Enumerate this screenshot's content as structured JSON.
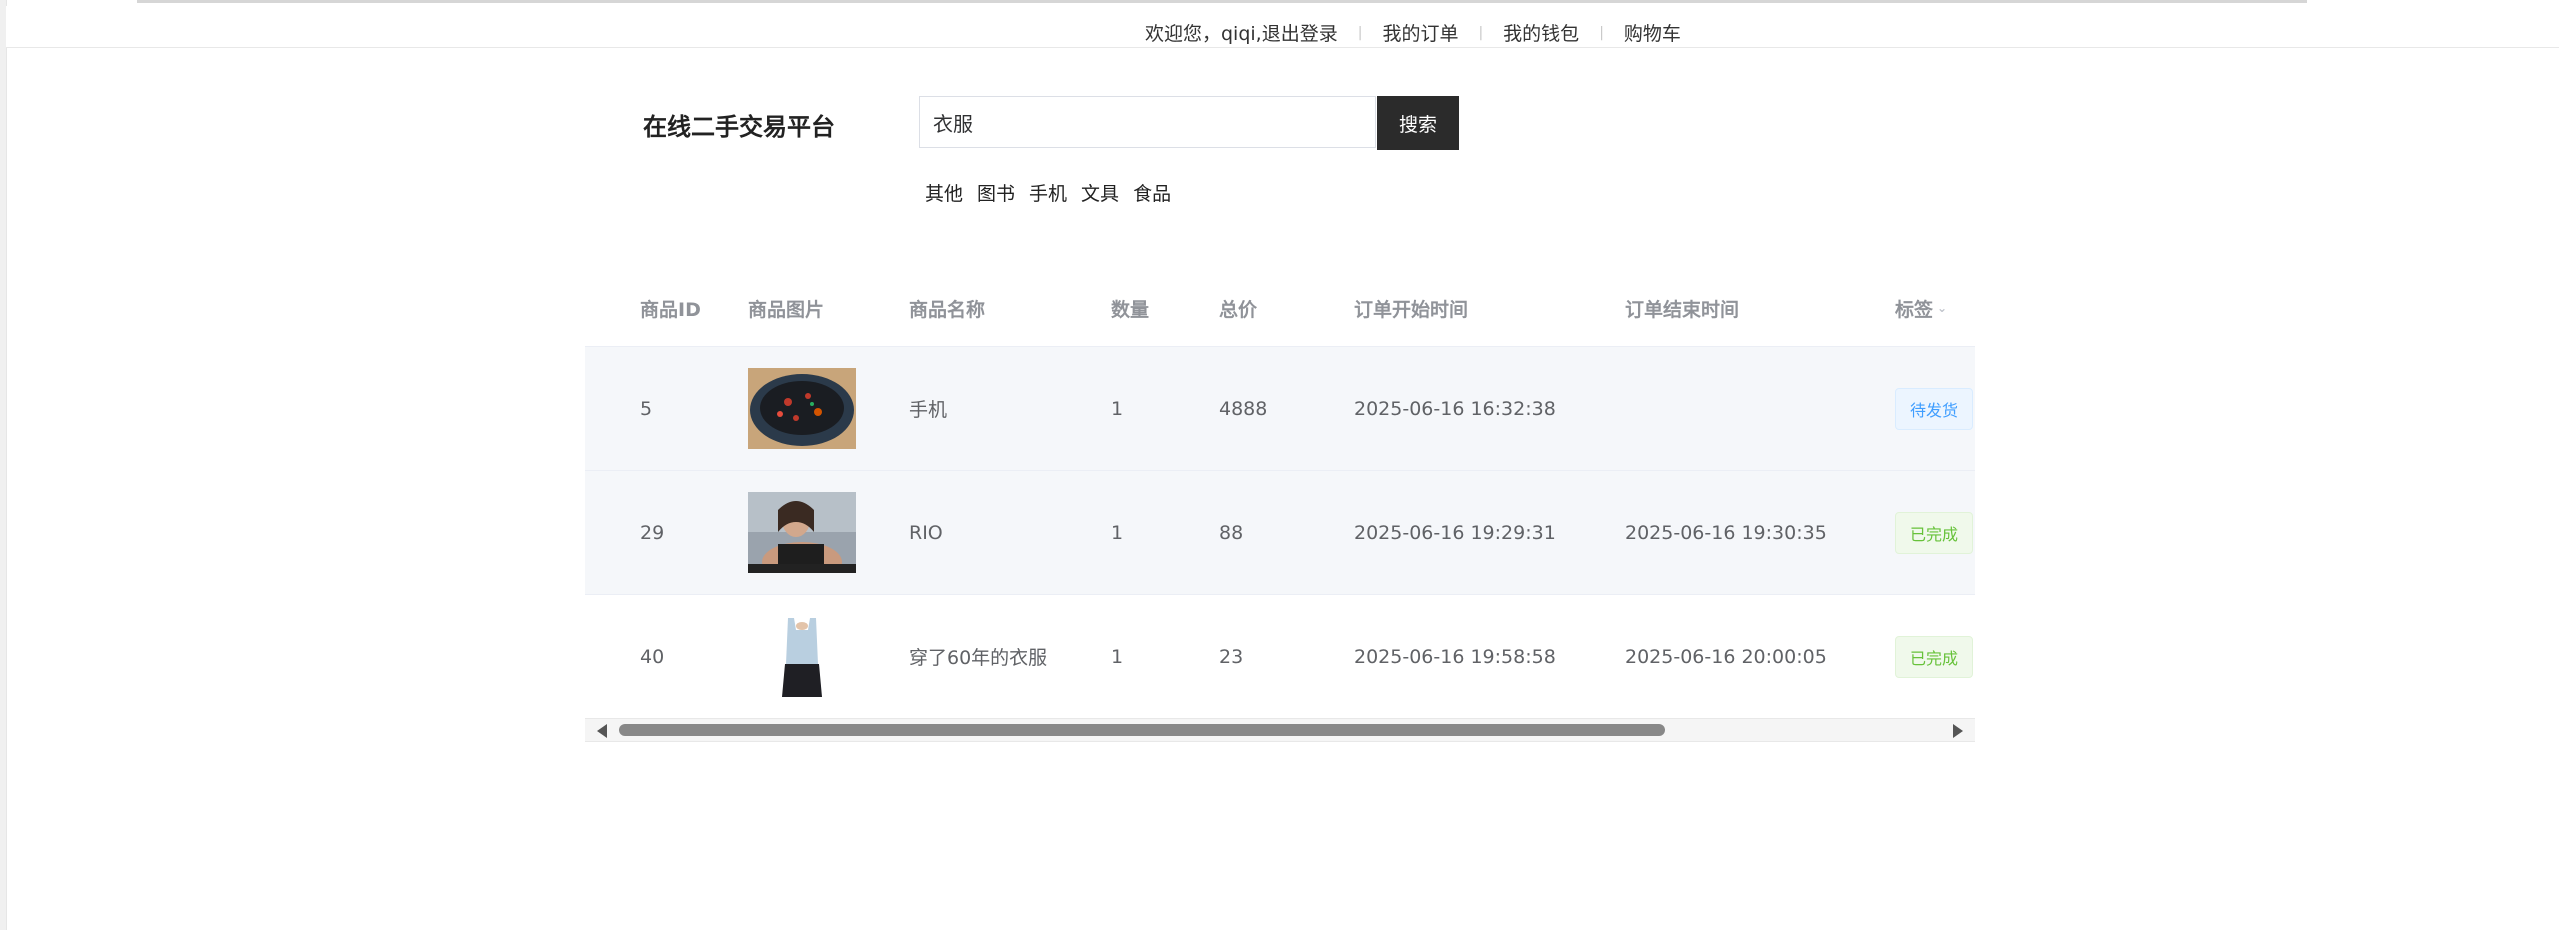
{
  "topnav": {
    "welcome": "欢迎您，qiqi,退出登录",
    "orders": "我的订单",
    "wallet": "我的钱包",
    "cart": "购物车",
    "separator": "|"
  },
  "header": {
    "logo": "在线二手交易平台",
    "search_value": "衣服",
    "search_button": "搜索",
    "categories": [
      "其他",
      "图书",
      "手机",
      "文具",
      "食品"
    ]
  },
  "table": {
    "columns": [
      "商品ID",
      "商品图片",
      "商品名称",
      "数量",
      "总价",
      "订单开始时间",
      "订单结束时间",
      "标签"
    ],
    "rows": [
      {
        "id": "5",
        "image": "food-photo",
        "name": "手机",
        "qty": "1",
        "price": "4888",
        "start": "2025-06-16 16:32:38",
        "end": "",
        "tag": "待发货",
        "tag_color": "#409eff"
      },
      {
        "id": "29",
        "image": "person-photo",
        "name": "RIO",
        "qty": "1",
        "price": "88",
        "start": "2025-06-16 19:29:31",
        "end": "2025-06-16 19:30:35",
        "tag": "已完成",
        "tag_color": "#67c23a"
      },
      {
        "id": "40",
        "image": "clothing-photo",
        "name": "穿了60年的衣服",
        "qty": "1",
        "price": "23",
        "start": "2025-06-16 19:58:58",
        "end": "2025-06-16 20:00:05",
        "tag": "已完成",
        "tag_color": "#67c23a"
      }
    ]
  },
  "icons": {
    "sort": "chevron-down-icon",
    "scroll_left": "arrow-left-icon",
    "scroll_right": "arrow-right-icon"
  }
}
